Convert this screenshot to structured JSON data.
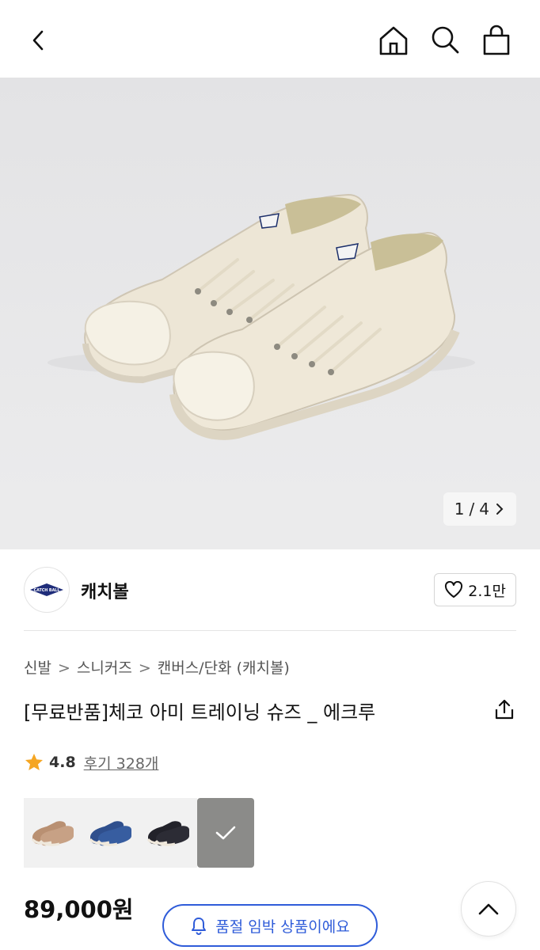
{
  "header": {
    "back_icon": "back-arrow-icon",
    "home_icon": "home-icon",
    "search_icon": "search-icon",
    "bag_icon": "shopping-bag-icon"
  },
  "gallery": {
    "current": "1",
    "separator": "/",
    "total": "4"
  },
  "brand": {
    "logo_text": "CATCH BALL",
    "name": "캐치볼",
    "likes": "2.1만"
  },
  "breadcrumb": [
    "신발",
    "스니커즈",
    "캔버스/단화 (캐치볼)"
  ],
  "product": {
    "title": "[무료반품]체코 아미 트레이닝 슈즈 _ 에크루",
    "rating": "4.8",
    "reviews": "후기 328개",
    "price": "89,000원"
  },
  "swatches": [
    {
      "color": "#b99072",
      "selected": false
    },
    {
      "color": "#2f4f8d",
      "selected": false
    },
    {
      "color": "#22222a",
      "selected": false
    },
    {
      "color": "#d8d3c6",
      "selected": true
    }
  ],
  "actions": {
    "restock_label": "품절 임박 상품이에요",
    "accent": "#2f5cd9"
  }
}
